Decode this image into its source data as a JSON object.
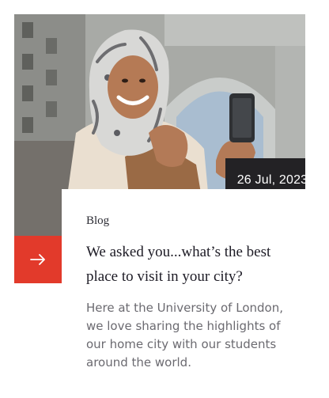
{
  "card": {
    "date": "26 Jul, 2023",
    "category": "Blog",
    "title": "We asked you...what’s the best place to visit in your city?",
    "excerpt": "Here at the University of London, we love sharing the highlights of our home city with our students around the world.",
    "arrow_icon": "arrow-right-icon"
  },
  "colors": {
    "accent": "#e23a2b",
    "date_badge_bg": "#232225",
    "title_text": "#1d1b25",
    "body_text": "#6b6a70"
  }
}
